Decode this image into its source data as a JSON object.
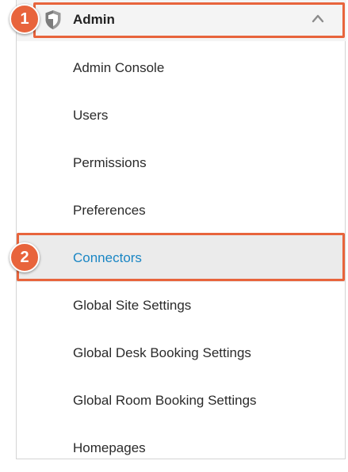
{
  "header": {
    "label": "Admin",
    "icon": "shield-icon",
    "toggle_icon": "chevron-up-icon",
    "expanded": true
  },
  "menu": {
    "items": [
      {
        "label": "Admin Console",
        "active": false
      },
      {
        "label": "Users",
        "active": false
      },
      {
        "label": "Permissions",
        "active": false
      },
      {
        "label": "Preferences",
        "active": false
      },
      {
        "label": "Connectors",
        "active": true
      },
      {
        "label": "Global Site Settings",
        "active": false
      },
      {
        "label": "Global Desk Booking Settings",
        "active": false
      },
      {
        "label": "Global Room Booking Settings",
        "active": false
      },
      {
        "label": "Homepages",
        "active": false
      }
    ]
  },
  "annotations": {
    "step_1": "1",
    "step_2": "2"
  },
  "colors": {
    "highlight": "#e8643c",
    "active_text": "#1a86c4",
    "active_background": "#ebebeb",
    "header_background": "#f4f4f4"
  }
}
